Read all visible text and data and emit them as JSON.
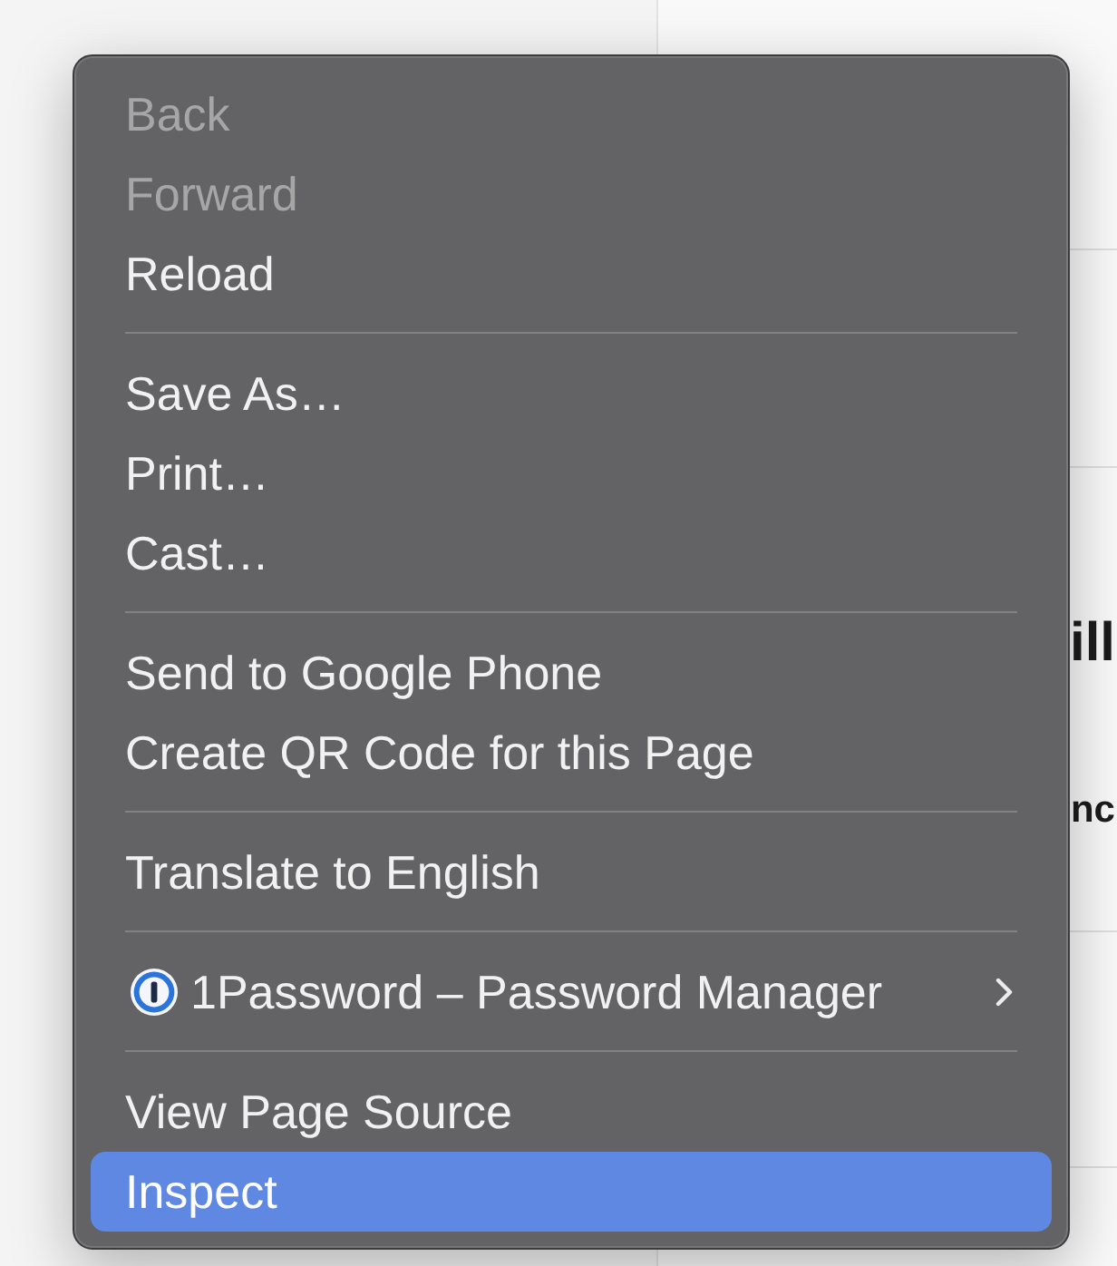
{
  "menu": {
    "items": [
      {
        "kind": "item",
        "label": "Back",
        "disabled": true,
        "selected": false
      },
      {
        "kind": "item",
        "label": "Forward",
        "disabled": true,
        "selected": false
      },
      {
        "kind": "item",
        "label": "Reload",
        "disabled": false,
        "selected": false
      },
      {
        "kind": "separator"
      },
      {
        "kind": "item",
        "label": "Save As…",
        "disabled": false,
        "selected": false
      },
      {
        "kind": "item",
        "label": "Print…",
        "disabled": false,
        "selected": false
      },
      {
        "kind": "item",
        "label": "Cast…",
        "disabled": false,
        "selected": false
      },
      {
        "kind": "separator"
      },
      {
        "kind": "item",
        "label": "Send to Google Phone",
        "disabled": false,
        "selected": false
      },
      {
        "kind": "item",
        "label": "Create QR Code for this Page",
        "disabled": false,
        "selected": false
      },
      {
        "kind": "separator"
      },
      {
        "kind": "item",
        "label": "Translate to English",
        "disabled": false,
        "selected": false
      },
      {
        "kind": "separator"
      },
      {
        "kind": "submenu",
        "label": "1Password – Password Manager",
        "disabled": false,
        "selected": false
      },
      {
        "kind": "separator"
      },
      {
        "kind": "item",
        "label": "View Page Source",
        "disabled": false,
        "selected": false
      },
      {
        "kind": "item",
        "label": "Inspect",
        "disabled": false,
        "selected": true
      }
    ]
  },
  "page_behind": {
    "fragments": [
      "ill",
      "nc"
    ]
  }
}
